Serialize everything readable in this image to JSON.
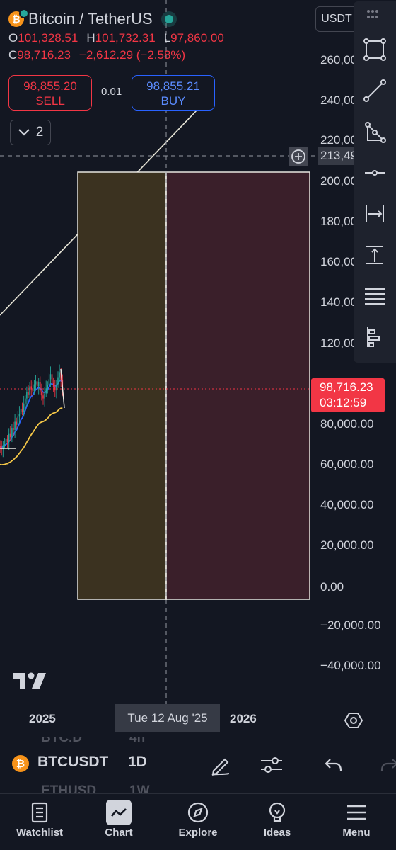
{
  "header": {
    "symbol_title": "Bitcoin / TetherUS",
    "coin_glyph": "₿",
    "ohlc_line1": [
      {
        "key": "O",
        "value": "101,328.51"
      },
      {
        "key": "H",
        "value": "101,732.31"
      },
      {
        "key": "L",
        "value": "97,860.00"
      }
    ],
    "ohlc_line2": [
      {
        "key": "C",
        "value": "98,716.23"
      },
      {
        "key": "",
        "value": "−2,612.29 (−2.58%)"
      }
    ],
    "sell_price": "98,855.20",
    "sell_label": "SELL",
    "buy_price": "98,855.21",
    "buy_label": "BUY",
    "spread": "0.01",
    "indicators_count": "2"
  },
  "price_axis": {
    "currency_button": "USDT",
    "labels": [
      "260,00",
      "240,00",
      "220,00",
      "200,00",
      "180,00",
      "160,00",
      "140,00",
      "120,00",
      "80,000.00",
      "60,000.00",
      "40,000.00",
      "20,000.00",
      "0.00",
      "−20,000.00",
      "−40,000.00"
    ],
    "crosshair_label": "213,49",
    "last_price": "98,716.23",
    "countdown": "03:12:59"
  },
  "time_axis": {
    "labels": [
      "2025",
      "2026"
    ],
    "crosshair_date": "Tue 12 Aug '25"
  },
  "toolbar": {
    "tools": [
      "rectangle-icon",
      "trend-line-icon",
      "triangle-icon",
      "horizontal-ray-icon",
      "date-range-icon",
      "price-range-icon",
      "parallel-lines-icon",
      "pin-tools-icon"
    ]
  },
  "symbol_bar": {
    "symbol": "BTCUSDT",
    "interval": "1D",
    "ghost_symbol_above": "BTC.D",
    "ghost_interval_above": "4h",
    "ghost_symbol_below": "ETHUSD",
    "ghost_interval_below": "1W"
  },
  "nav": {
    "items": [
      {
        "label": "Watchlist",
        "icon": "watchlist-icon"
      },
      {
        "label": "Chart",
        "icon": "chart-icon"
      },
      {
        "label": "Explore",
        "icon": "explore-icon"
      },
      {
        "label": "Ideas",
        "icon": "ideas-icon"
      },
      {
        "label": "Menu",
        "icon": "menu-icon"
      }
    ],
    "active": "Chart"
  },
  "colors": {
    "background": "#131722",
    "down": "#f23645",
    "up": "#26a69a",
    "buy": "#2962ff",
    "zone_left": "#3b3220",
    "zone_right": "#3a1f2a",
    "ema_fast": "#2962ff",
    "ema_slow": "#f7c948"
  },
  "chart_data": {
    "type": "candlestick",
    "symbol": "BTCUSDT",
    "interval": "1D",
    "close": [
      70000,
      69000,
      68500,
      70500,
      71000,
      73500,
      72000,
      76000,
      74500,
      79000,
      78000,
      82000,
      80500,
      84500,
      86000,
      88500,
      87000,
      91000,
      93500,
      96500,
      95500,
      99500,
      98000,
      97000,
      100500,
      102000,
      99500,
      101500,
      97000,
      95000,
      93500,
      96000,
      98500,
      100000,
      103000,
      105500,
      101000,
      99000,
      97500,
      100500,
      104000,
      106500,
      102500,
      98716.23
    ],
    "last_price": 98716.23,
    "ylim": [
      -45000,
      270000
    ]
  }
}
